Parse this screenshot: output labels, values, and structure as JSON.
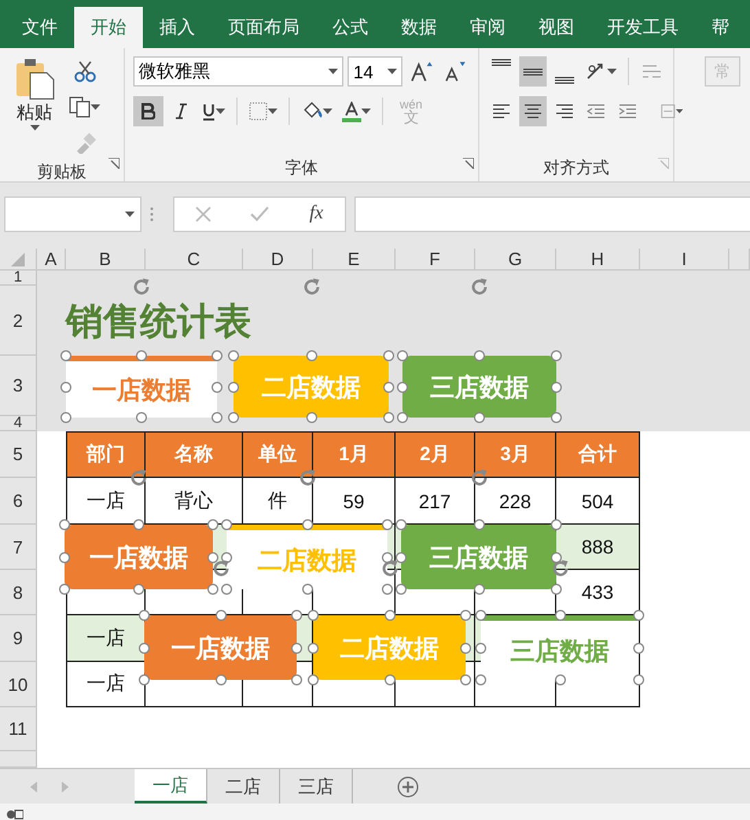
{
  "menu_tabs": [
    {
      "label": "文件",
      "selected": false
    },
    {
      "label": "开始",
      "selected": true
    },
    {
      "label": "插入",
      "selected": false
    },
    {
      "label": "页面布局",
      "selected": false
    },
    {
      "label": "公式",
      "selected": false
    },
    {
      "label": "数据",
      "selected": false
    },
    {
      "label": "审阅",
      "selected": false
    },
    {
      "label": "视图",
      "selected": false
    },
    {
      "label": "开发工具",
      "selected": false
    },
    {
      "label": "帮",
      "selected": false
    }
  ],
  "clipboard": {
    "paste_label": "粘贴",
    "group_label": "剪贴板"
  },
  "font": {
    "font_name": "微软雅黑",
    "font_size": "14",
    "bold": true,
    "italic": false,
    "underline": false,
    "phonetic_label": "wén",
    "phonetic_char": "文",
    "group_label": "字体"
  },
  "alignment": {
    "vertical": [
      {
        "kind": "top",
        "selected": false
      },
      {
        "kind": "middle",
        "selected": true
      },
      {
        "kind": "bottom",
        "selected": false
      }
    ],
    "horizontal": [
      {
        "kind": "left",
        "selected": false
      },
      {
        "kind": "center",
        "selected": true
      },
      {
        "kind": "right",
        "selected": false
      }
    ],
    "group_label": "对齐方式"
  },
  "styles_button": {
    "label": "常",
    "disabled": true
  },
  "formula_bar": {
    "function_label": "fx"
  },
  "sheet": {
    "columns": [
      "A",
      "B",
      "C",
      "D",
      "E",
      "F",
      "G",
      "H",
      "I"
    ],
    "rows": [
      "1",
      "2",
      "3",
      "4",
      "5",
      "6",
      "7",
      "8",
      "9",
      "10",
      "11"
    ],
    "title": "销售统计表",
    "table": {
      "header": [
        "部门",
        "名称",
        "单位",
        "1月",
        "2月",
        "3月",
        "合计"
      ],
      "rows": [
        {
          "highlighted": false,
          "cells": [
            "一店",
            "背心",
            "件",
            "59",
            "217",
            "228",
            "504"
          ]
        },
        {
          "highlighted": true,
          "cells": [
            null,
            null,
            null,
            null,
            null,
            null,
            "888"
          ]
        },
        {
          "highlighted": false,
          "cells": [
            null,
            null,
            null,
            null,
            null,
            null,
            "433"
          ]
        },
        {
          "highlighted": true,
          "cells": [
            "一店",
            null,
            null,
            null,
            null,
            null,
            null
          ]
        },
        {
          "highlighted": false,
          "cells": [
            "一店",
            null,
            null,
            null,
            null,
            null,
            null
          ]
        }
      ]
    }
  },
  "shapes": [
    {
      "label": "一店数据",
      "kind": "outline",
      "color": "#ed7d31",
      "selected": true
    },
    {
      "label": "二店数据",
      "kind": "filled",
      "color": "#ffc000",
      "selected": true
    },
    {
      "label": "三店数据",
      "kind": "filled",
      "color": "#70ad47",
      "selected": true
    },
    {
      "label": "一店数据",
      "kind": "filled",
      "color": "#ed7d31",
      "selected": true
    },
    {
      "label": "二店数据",
      "kind": "outline",
      "color": "#ffc000",
      "selected": true
    },
    {
      "label": "三店数据",
      "kind": "filled",
      "color": "#70ad47",
      "selected": true
    },
    {
      "label": "一店数据",
      "kind": "filled",
      "color": "#ed7d31",
      "selected": true
    },
    {
      "label": "二店数据",
      "kind": "filled",
      "color": "#ffc000",
      "selected": true
    },
    {
      "label": "三店数据",
      "kind": "outline",
      "color": "#70ad47",
      "selected": true
    }
  ],
  "sheet_tabs": [
    {
      "label": "一店",
      "selected": true
    },
    {
      "label": "二店",
      "selected": false
    },
    {
      "label": "三店",
      "selected": false
    }
  ]
}
